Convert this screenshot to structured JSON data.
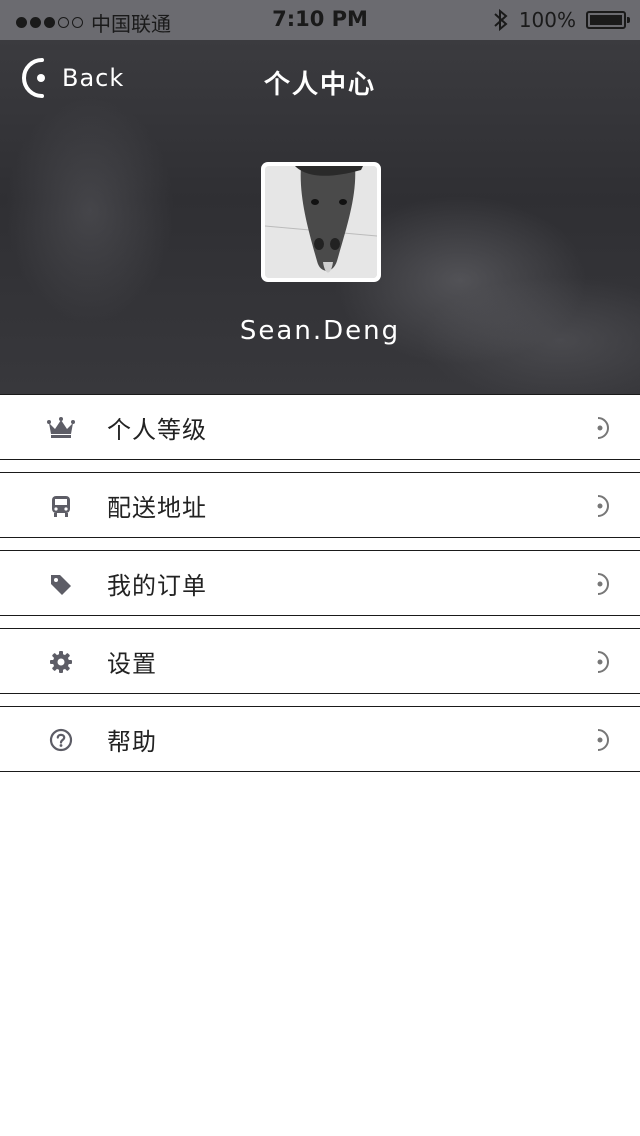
{
  "status_bar": {
    "carrier": "中国联通",
    "time": "7:10 PM",
    "battery": "100%",
    "signal_icon": "signal-dots-icon",
    "bluetooth_icon": "bluetooth-icon",
    "battery_icon": "battery-icon"
  },
  "nav": {
    "back_label": "Back",
    "back_icon": "back-icon",
    "title": "个人中心"
  },
  "profile": {
    "avatar": "horse-avatar-image",
    "username": "Sean.Deng"
  },
  "menu": {
    "items": [
      {
        "label": "个人等级",
        "icon": "crown-icon"
      },
      {
        "label": "配送地址",
        "icon": "bus-icon"
      },
      {
        "label": "我的订单",
        "icon": "tag-icon"
      },
      {
        "label": "设置",
        "icon": "gear-icon"
      },
      {
        "label": "帮助",
        "icon": "help-circle-icon"
      }
    ],
    "chevron_icon": "chevron-right-icon"
  }
}
